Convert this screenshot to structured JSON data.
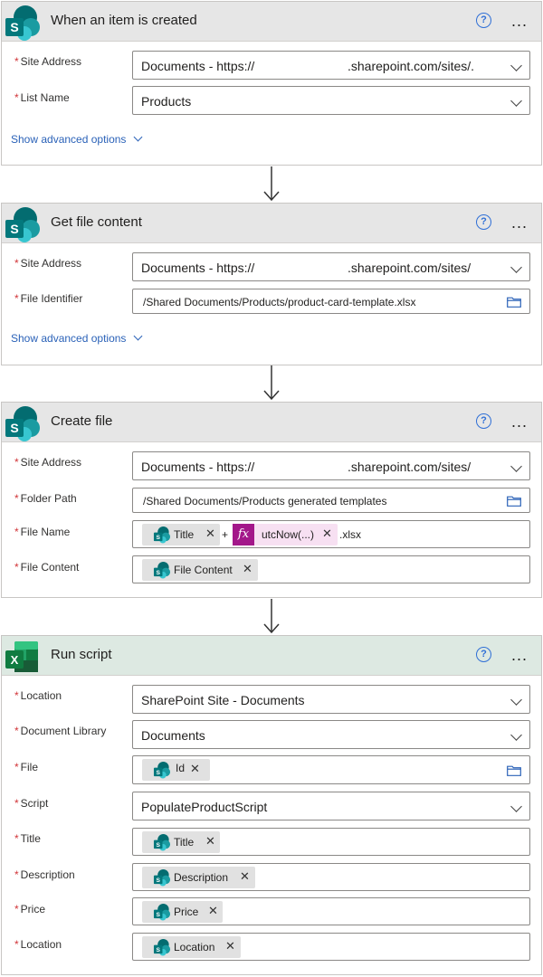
{
  "cards": [
    {
      "id": "trigger",
      "title": "When an item is created",
      "help": "?",
      "more": "...",
      "fields": [
        {
          "label": "Site Address",
          "value": "Documents - https://",
          "value_suffix": ".sharepoint.com/sites/."
        },
        {
          "label": "List Name",
          "value": "Products"
        }
      ],
      "advanced_label": "Show advanced options"
    },
    {
      "id": "get-file",
      "title": "Get file content",
      "help": "?",
      "more": "...",
      "fields": [
        {
          "label": "Site Address",
          "value": "Documents - https://",
          "value_suffix": ".sharepoint.com/sites/"
        },
        {
          "label": "File Identifier",
          "value": "/Shared Documents/Products/product-card-template.xlsx"
        }
      ],
      "advanced_label": "Show advanced options"
    },
    {
      "id": "create-file",
      "title": "Create file",
      "help": "?",
      "more": "...",
      "fields": [
        {
          "label": "Site Address",
          "value": "Documents - https://",
          "value_suffix": ".sharepoint.com/sites/"
        },
        {
          "label": "Folder Path",
          "value": "/Shared Documents/Products generated templates"
        },
        {
          "label": "File Name",
          "token1": "Title",
          "plus": "+",
          "fx_icon": "fx",
          "token2": "utcNow(...)",
          "suffix": ".xlsx"
        },
        {
          "label": "File Content",
          "token": "File Content"
        }
      ]
    },
    {
      "id": "run-script",
      "title": "Run script",
      "help": "?",
      "more": "...",
      "fields": [
        {
          "label": "Location",
          "value": "SharePoint Site - Documents"
        },
        {
          "label": "Document Library",
          "value": "Documents"
        },
        {
          "label": "File",
          "token": "Id"
        },
        {
          "label": "Script",
          "value": "PopulateProductScript"
        },
        {
          "label": "Title",
          "token": "Title"
        },
        {
          "label": "Description",
          "token": "Description"
        },
        {
          "label": "Price",
          "token": "Price"
        },
        {
          "label": "Location",
          "token": "Location"
        }
      ]
    }
  ],
  "required_marker": "*",
  "remove_glyph": "✕",
  "icons": {
    "sharepoint": "sharepoint-icon",
    "excel": "excel-icon",
    "folder": "folder-icon",
    "chevron": "chevron-down-icon"
  },
  "colors": {
    "sharepoint_teal": "#038387",
    "excel_green": "#1e7145",
    "link_blue": "#2b62b8",
    "required_red": "#d13438",
    "fx_purple": "#a3178a"
  }
}
